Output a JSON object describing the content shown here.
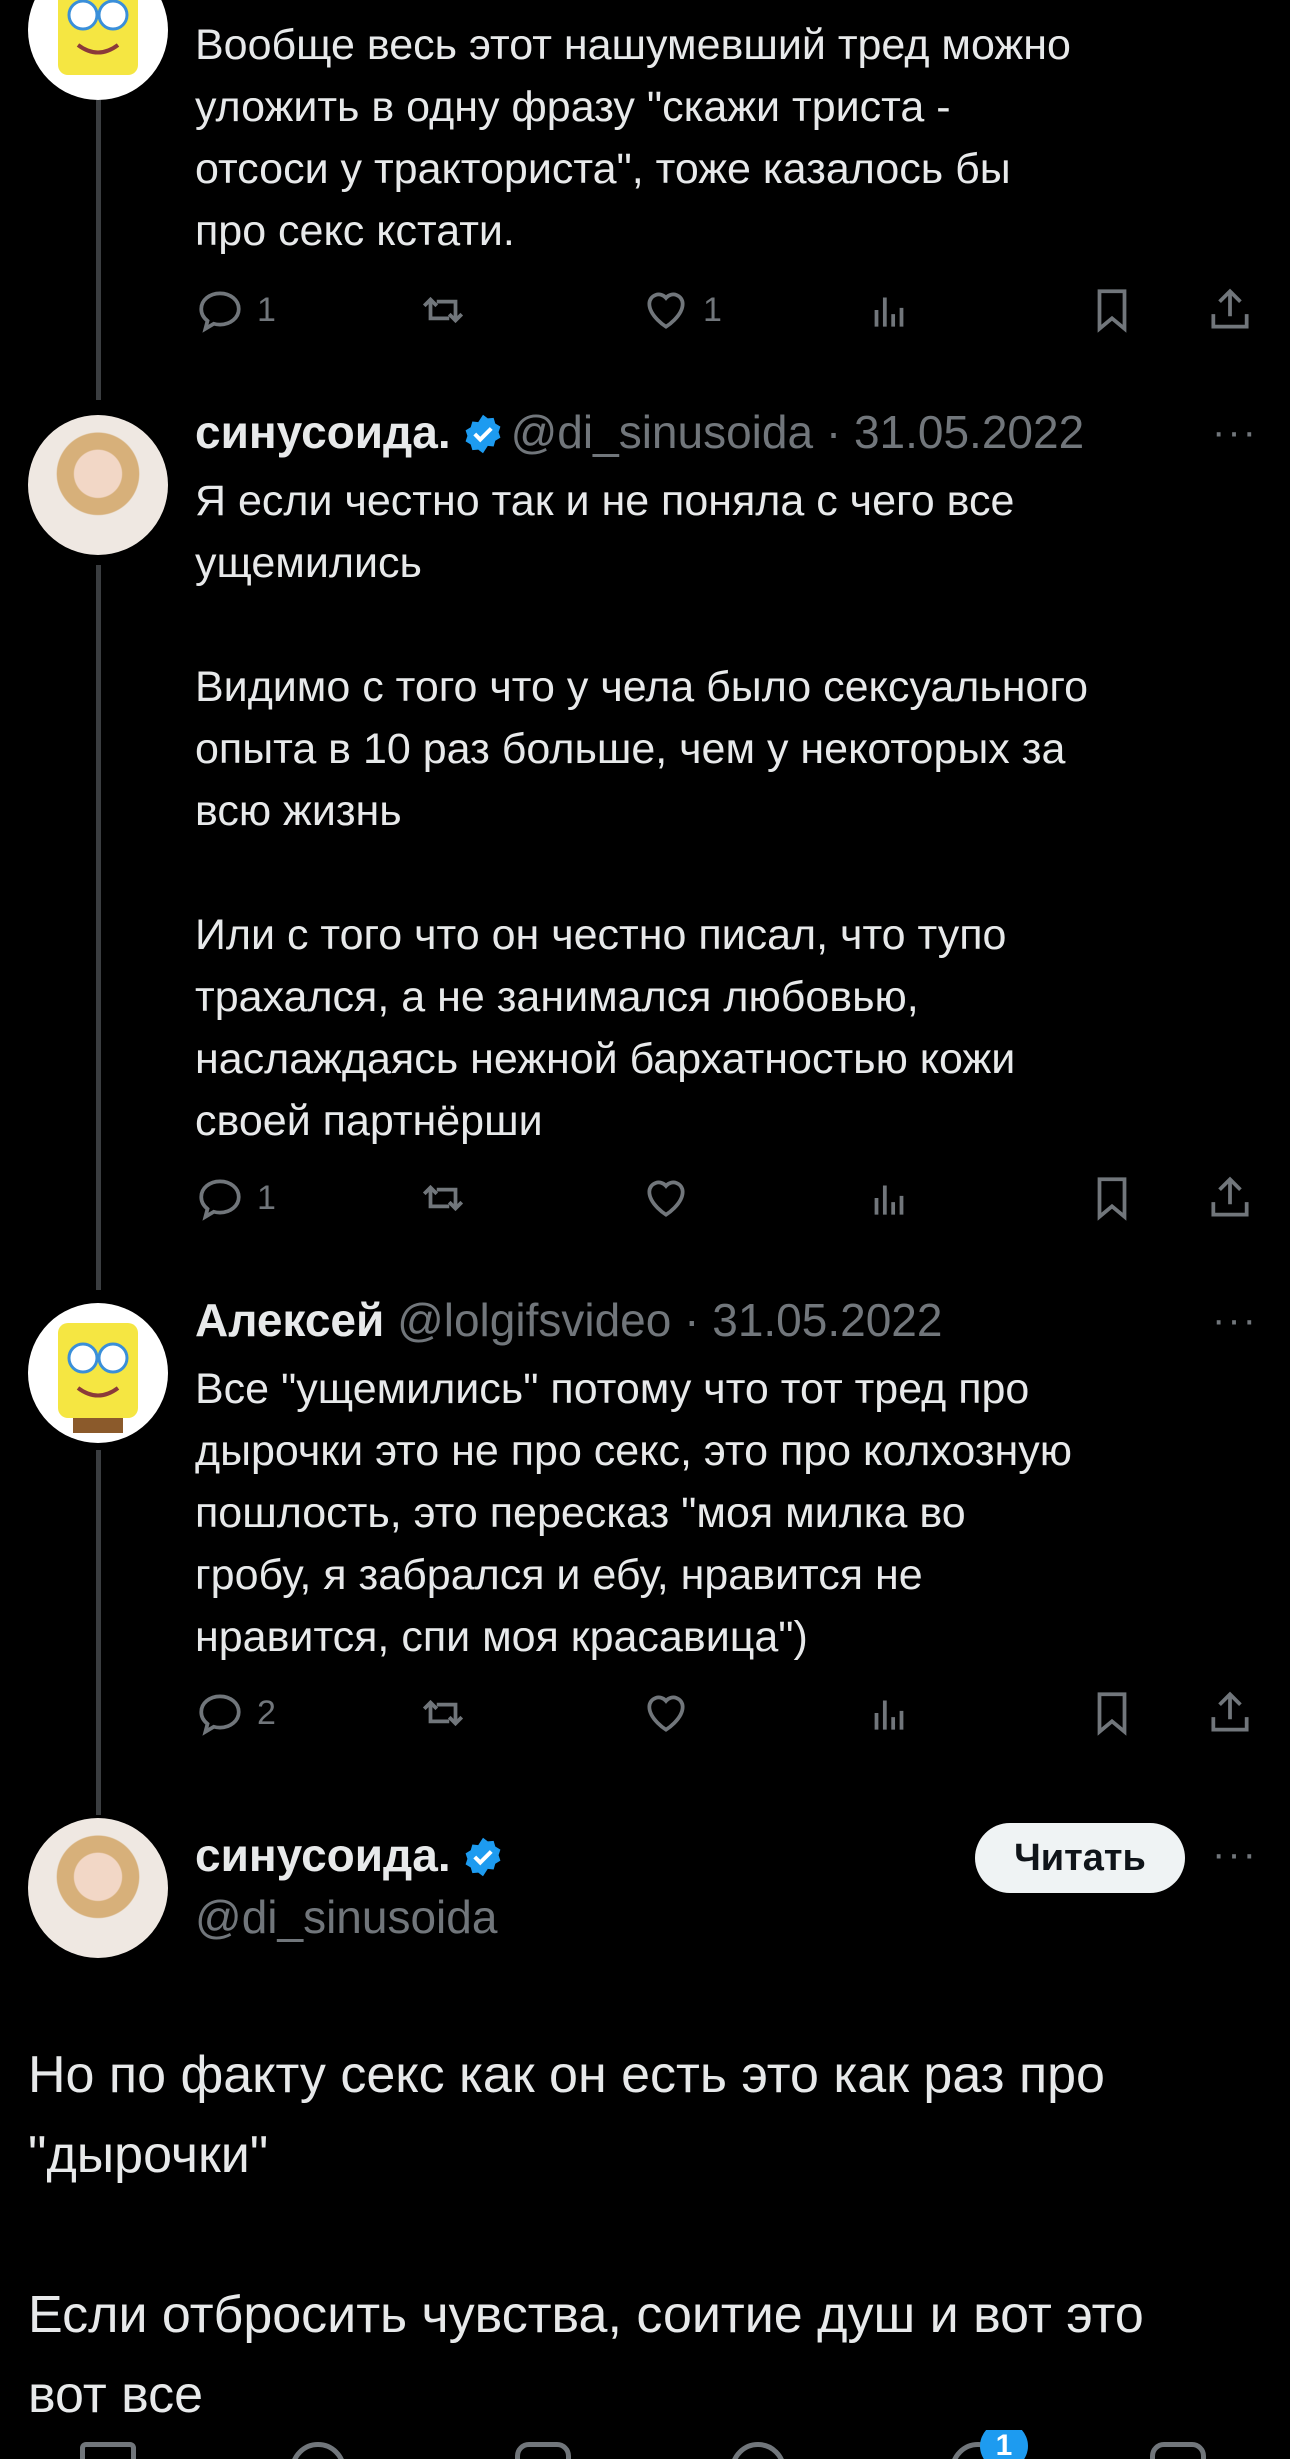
{
  "tweets": [
    {
      "text": "Вообще весь этот нашумевший тред можно\nуложить в одну фразу \"скажи триста -\nотсоси у тракториста\", тоже казалось бы\nпро секс кстати.",
      "replies": "1",
      "likes": "1"
    },
    {
      "name": "синусоида.",
      "handle": "@di_sinusoida",
      "sep": "·",
      "date": "31.05.2022",
      "more": "···",
      "text": "Я если честно так и не поняла с чего все\nущемились\n\nВидимо с того что у чела было сексуального\nопыта в 10 раз больше, чем у некоторых за\nвсю жизнь\n\nИли с того что он честно писал, что тупо\nтрахался, а не занимался любовью,\nнаслаждаясь нежной бархатностью кожи\nсвоей партнёрши",
      "replies": "1"
    },
    {
      "name": "Алексей",
      "handle": "@lolgifsvideo",
      "sep": "·",
      "date": "31.05.2022",
      "more": "···",
      "text": "Все \"ущемились\" потому что тот тред про\nдырочки это не про секс, это про колхозную\nпошлость, это пересказ \"моя милка во\nгробу, я забрался и ебу, нравится не\nнравится, спи моя красавица\")",
      "replies": "2"
    }
  ],
  "main_tweet": {
    "name": "синусоида.",
    "handle": "@di_sinusoida",
    "follow_label": "Читать",
    "more": "···",
    "text": "Но по факту секс как он есть это как раз про\n\"дырочки\"\n\nЕсли отбросить чувства, соитие душ и вот это\nвот все"
  },
  "bottom_nav": {
    "notifications_badge": "1"
  },
  "colors": {
    "background": "#000000",
    "text": "#e7e9ea",
    "muted": "#71767b",
    "verified": "#1d9bf0",
    "line": "#3a3d40"
  }
}
